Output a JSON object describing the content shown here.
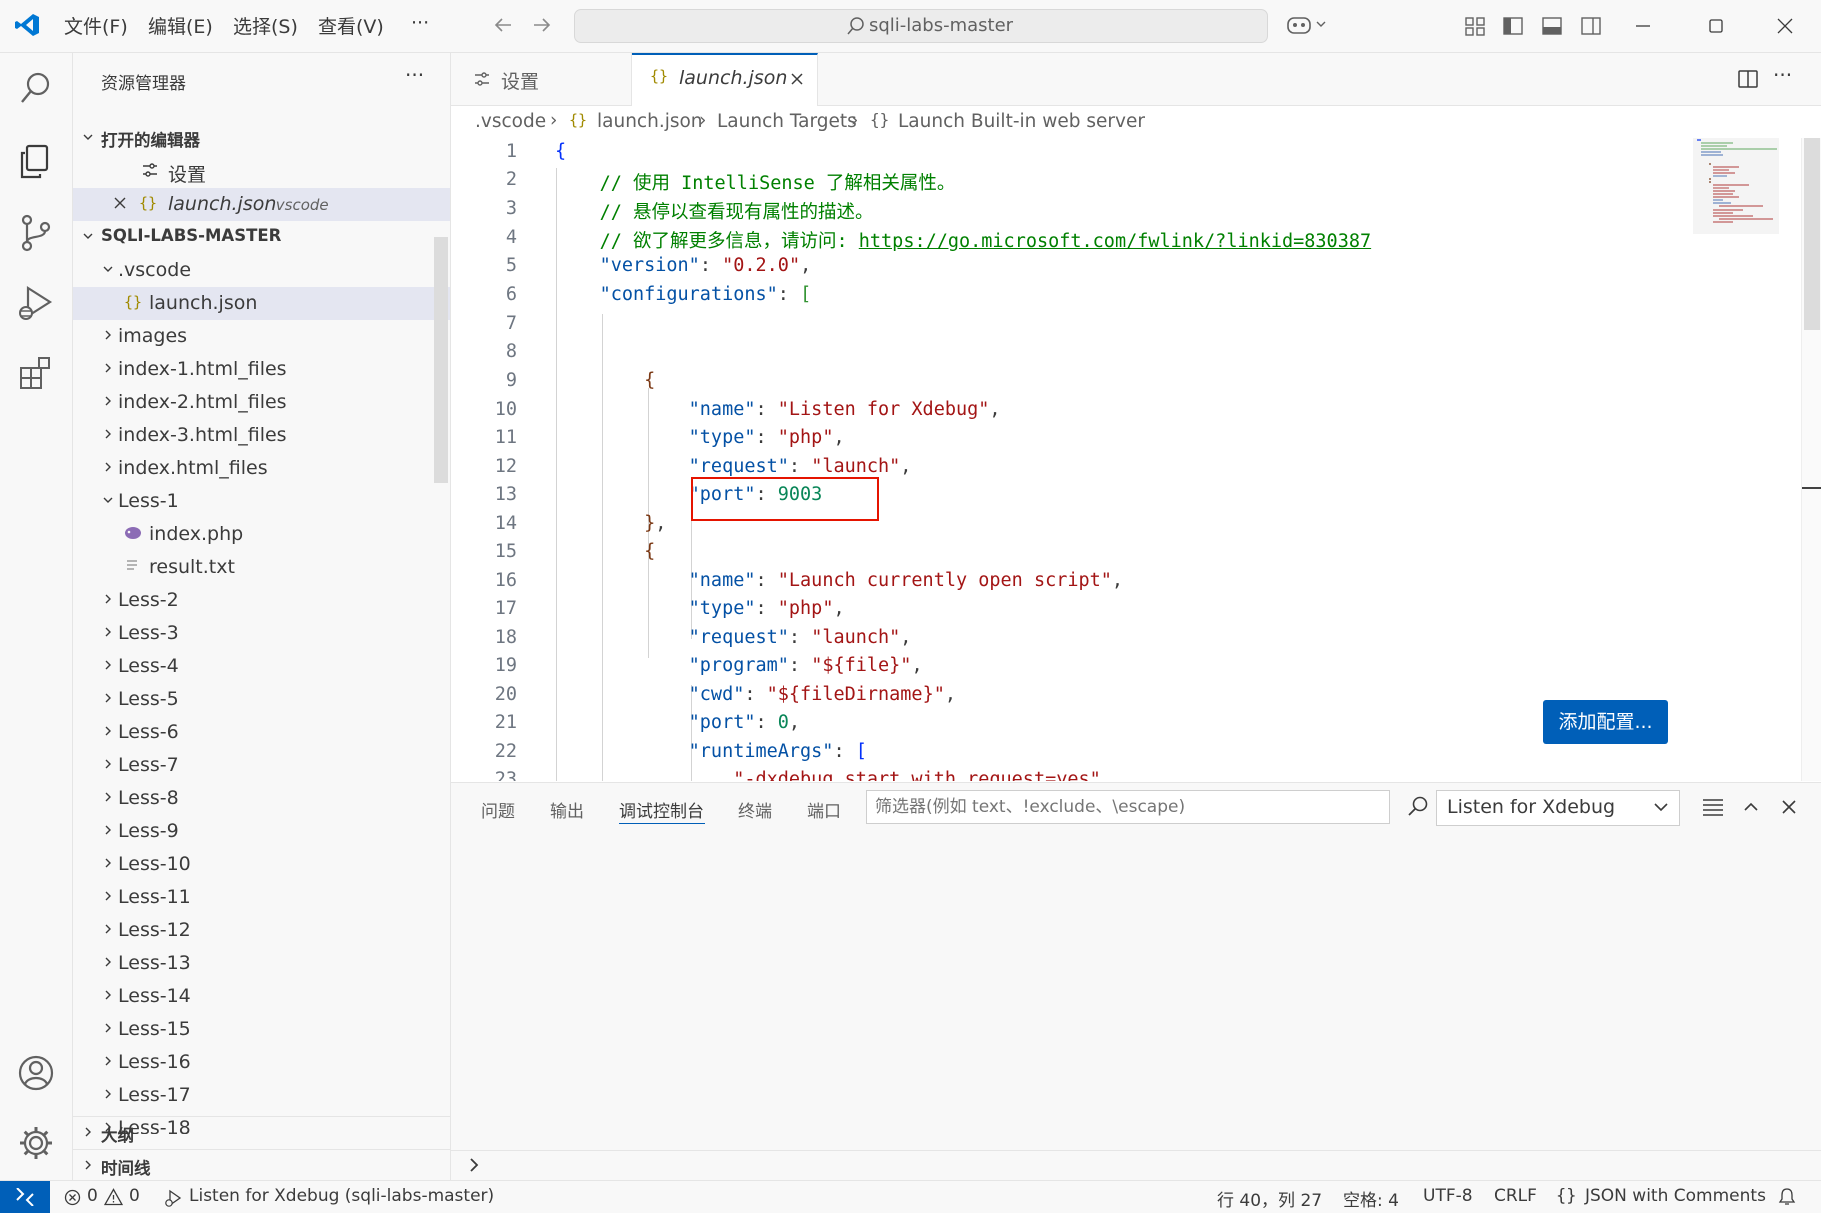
{
  "titlebar": {
    "menus": [
      "文件(F)",
      "编辑(E)",
      "选择(S)",
      "查看(V)",
      "···"
    ],
    "search_text": "sqli-labs-master"
  },
  "sidebar": {
    "title": "资源管理器",
    "more": "···",
    "open_editors": {
      "header": "打开的编辑器",
      "items": [
        {
          "label": "设置",
          "desc": ""
        },
        {
          "label": "launch.json",
          "desc": ".vscode"
        }
      ]
    },
    "folder": {
      "header": "SQLI-LABS-MASTER",
      "items": [
        ".vscode",
        "launch.json",
        "images",
        "index-1.html_files",
        "index-2.html_files",
        "index-3.html_files",
        "index.html_files",
        "Less-1",
        "index.php",
        "result.txt",
        "Less-2",
        "Less-3",
        "Less-4",
        "Less-5",
        "Less-6",
        "Less-7",
        "Less-8",
        "Less-9",
        "Less-10",
        "Less-11",
        "Less-12",
        "Less-13",
        "Less-14",
        "Less-15",
        "Less-16",
        "Less-17",
        "Less-18"
      ]
    },
    "outline": "大纲",
    "timeline": "时间线"
  },
  "tabs": [
    {
      "label": "设置",
      "icon": "settings-icon"
    },
    {
      "label": "launch.json",
      "icon": "json-braces-icon"
    }
  ],
  "breadcrumb": [
    ".vscode",
    "launch.json",
    "Launch Targets",
    "Launch Built-in web server"
  ],
  "editor": {
    "line_numbers": [
      "1",
      "2",
      "3",
      "4",
      "5",
      "6",
      "7",
      "8",
      "9",
      "10",
      "11",
      "12",
      "13",
      "14",
      "15",
      "16",
      "17",
      "18",
      "19",
      "20",
      "21",
      "22",
      "23"
    ],
    "comment_1": "// 使用 IntelliSense 了解相关属性。",
    "comment_2": "// 悬停以查看现有属性的描述。",
    "comment_3": "// 欲了解更多信息，请访问: ",
    "link": "https://go.microsoft.com/fwlink/?linkid=830387",
    "version": "0.2.0",
    "conf1": {
      "name": "Listen for Xdebug",
      "type": "php",
      "request": "launch",
      "port": "9003"
    },
    "conf2": {
      "name": "Launch currently open script",
      "type": "php",
      "request": "launch",
      "program": "${file}",
      "cwd": "${fileDirname}",
      "port": "0"
    },
    "line23": "\"-dxdebug.start_with_request=yes\","
  },
  "add_config_button": "添加配置...",
  "panel": {
    "tabs": [
      "问题",
      "输出",
      "调试控制台",
      "终端",
      "端口"
    ],
    "active_tab": "调试控制台",
    "filter_placeholder": "筛选器(例如 text、!exclude、\\escape)",
    "debug_select": "Listen for Xdebug"
  },
  "statusbar": {
    "errors": "0",
    "warnings": "0",
    "debug_target": "Listen for Xdebug (sqli-labs-master)",
    "position": "行 40，列 27",
    "spaces": "空格: 4",
    "encoding": "UTF-8",
    "eol": "CRLF",
    "language_icon": "{}",
    "language": "JSON with Comments"
  },
  "colors": {
    "accent": "#005fb8",
    "highlight_box": "#e51400"
  }
}
